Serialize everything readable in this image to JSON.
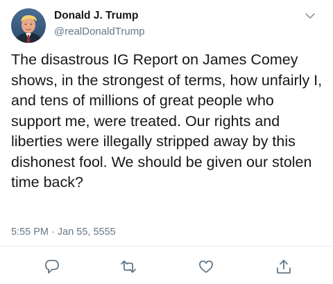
{
  "tweet": {
    "author": {
      "name": "Donald J. Trump",
      "handle": "@realDonaldTrump",
      "avatar_icon": "profile-photo"
    },
    "text": "The disastrous IG Report on James Comey shows, in the strongest of terms, how unfairly I, and tens of millions of great people who support me, were treated. Our rights and liberties were illegally stripped away by this dishonest fool. We should be given our stolen time back?",
    "timestamp": "5:55 PM · Jan 55, 5555",
    "actions": [
      {
        "name": "reply",
        "icon": "comment-bubble-icon"
      },
      {
        "name": "retweet",
        "icon": "retweet-arrows-icon"
      },
      {
        "name": "like",
        "icon": "heart-outline-icon"
      },
      {
        "name": "share",
        "icon": "share-upload-icon"
      }
    ],
    "menu_icon": "chevron-down-icon"
  },
  "colors": {
    "primary_text": "#14171a",
    "secondary_text": "#657786",
    "icon": "#657786",
    "divider": "#e6ecf0",
    "background": "#ffffff"
  }
}
